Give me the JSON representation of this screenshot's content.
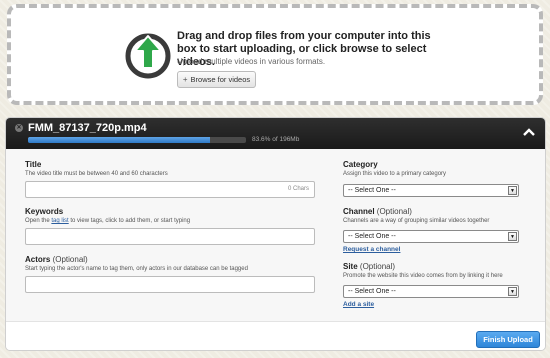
{
  "dropzone": {
    "title": "Drag and drop files from your computer into this box to start uploading, or click browse to select videos.",
    "subtitle": "Upload multiple videos in various formats.",
    "browse_label": "Browse for videos",
    "icon": "upload-arrow-icon",
    "icon_color": "#2fa84a"
  },
  "upload": {
    "file_name": "FMM_87137_720p.mp4",
    "progress_percent": 83.6,
    "progress_text": "83.6% of 196Mb",
    "progress_color": "#3b87d6"
  },
  "form": {
    "title": {
      "label": "Title",
      "help": "The video title must be between 40 and 60 characters",
      "value": "",
      "char_count": "0 Chars"
    },
    "keywords": {
      "label": "Keywords",
      "help_before": "Open the",
      "help_link": "tag list",
      "help_after": "to view tags, click to add them, or start typing",
      "value": ""
    },
    "actors": {
      "label": "Actors",
      "optional": "(Optional)",
      "help": "Start typing the actor's name to tag them, only actors in our database can be tagged",
      "value": ""
    },
    "category": {
      "label": "Category",
      "help": "Assign this video to a primary category",
      "selected": "-- Select One --"
    },
    "channel": {
      "label": "Channel",
      "optional": "(Optional)",
      "help": "Channels are a way of grouping similar videos together",
      "selected": "-- Select One --",
      "link": "Request a channel"
    },
    "site": {
      "label": "Site",
      "optional": "(Optional)",
      "help": "Promote the website this video comes from by linking it here",
      "selected": "-- Select One --",
      "link": "Add a site"
    }
  },
  "footer": {
    "finish_label": "Finish Upload",
    "finish_color": "#3b8ee0"
  }
}
